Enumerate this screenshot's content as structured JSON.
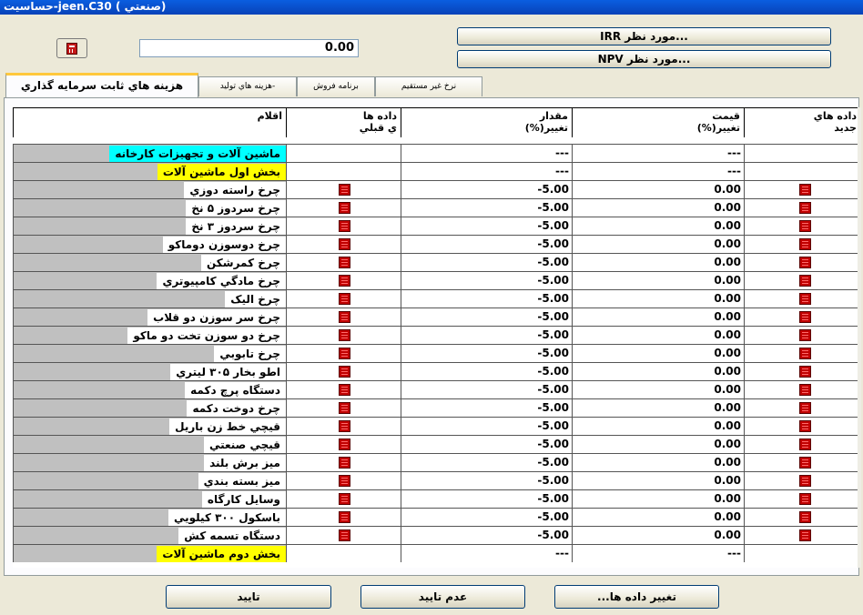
{
  "window": {
    "title": "حساسيت-jeen.C30 ( صنعتي)"
  },
  "icons": {
    "calculator": "calculator-icon",
    "grid_button": "red-grid-icon"
  },
  "colors": {
    "title_bar": "#0a5ee0",
    "tab_accent": "#ffc83c",
    "group_highlight": "#00ffff",
    "section_highlight": "#ffff00",
    "cell_button": "#c00000"
  },
  "top": {
    "value": "0.00",
    "irr_button": "IRR مورد نظر...",
    "npv_button": "NPV مورد نظر..."
  },
  "tabs": [
    {
      "label": "هزينه هاي ثابت سرمايه گذاري"
    },
    {
      "label": "هزينه هاي توليد-"
    },
    {
      "label": "برنامه فروش"
    },
    {
      "label": "نرخ غير مستقيم"
    }
  ],
  "columns": {
    "items": "اقلام",
    "old_data_1": "داده ها",
    "old_data_2": "ي قبلي",
    "qty_1": "مقدار",
    "qty_2": "تغيير(%)",
    "price_1": "قيمت",
    "price_2": "تغيير(%)",
    "new_data_1": "داده هاي",
    "new_data_2": "جديد"
  },
  "rows": [
    {
      "label": "ماشين آلات و تجهيزات كارخانه",
      "qty": "---",
      "price": "---"
    },
    {
      "label": "بخش اول ماشين آلات",
      "qty": "---",
      "price": "---"
    },
    {
      "label": "چرخ راسته دوزي",
      "qty": "-5.00",
      "price": "0.00"
    },
    {
      "label": "چرخ سردوز ۵ نخ",
      "qty": "-5.00",
      "price": "0.00"
    },
    {
      "label": "چرخ سردوز ۳ نخ",
      "qty": "-5.00",
      "price": "0.00"
    },
    {
      "label": "چرخ دوسوزن دوماكو",
      "qty": "-5.00",
      "price": "0.00"
    },
    {
      "label": "چرخ كمرشكن",
      "qty": "-5.00",
      "price": "0.00"
    },
    {
      "label": "چرخ مادگي كامپيوتري",
      "qty": "-5.00",
      "price": "0.00"
    },
    {
      "label": "چرخ اليک",
      "qty": "-5.00",
      "price": "0.00"
    },
    {
      "label": "چرخ سر سوزن دو قلاب",
      "qty": "-5.00",
      "price": "0.00"
    },
    {
      "label": "چرخ دو سوزن تخت دو ماكو",
      "qty": "-5.00",
      "price": "0.00"
    },
    {
      "label": "چرخ تابوبي",
      "qty": "-5.00",
      "price": "0.00"
    },
    {
      "label": "اطو بخار ۳۰۵ ليتري",
      "qty": "-5.00",
      "price": "0.00"
    },
    {
      "label": "دستگاه پرچ دكمه",
      "qty": "-5.00",
      "price": "0.00"
    },
    {
      "label": "چرخ دوخت دكمه",
      "qty": "-5.00",
      "price": "0.00"
    },
    {
      "label": "قيچي خط زن باريل",
      "qty": "-5.00",
      "price": "0.00"
    },
    {
      "label": "قيچي صنعتي",
      "qty": "-5.00",
      "price": "0.00"
    },
    {
      "label": "ميز برش بلند",
      "qty": "-5.00",
      "price": "0.00"
    },
    {
      "label": "ميز بسته بندي",
      "qty": "-5.00",
      "price": "0.00"
    },
    {
      "label": "وسايل كارگاه",
      "qty": "-5.00",
      "price": "0.00"
    },
    {
      "label": "باسكول ۳۰۰ كيلويي",
      "qty": "-5.00",
      "price": "0.00"
    },
    {
      "label": "دستگاه تسمه كش",
      "qty": "-5.00",
      "price": "0.00"
    },
    {
      "label": "بخش دوم ماشين آلات",
      "qty": "---",
      "price": "---"
    }
  ],
  "buttons": {
    "ok": "تاييد",
    "cancel": "عدم تاييد",
    "change_data": "تغيير داده ها..."
  }
}
